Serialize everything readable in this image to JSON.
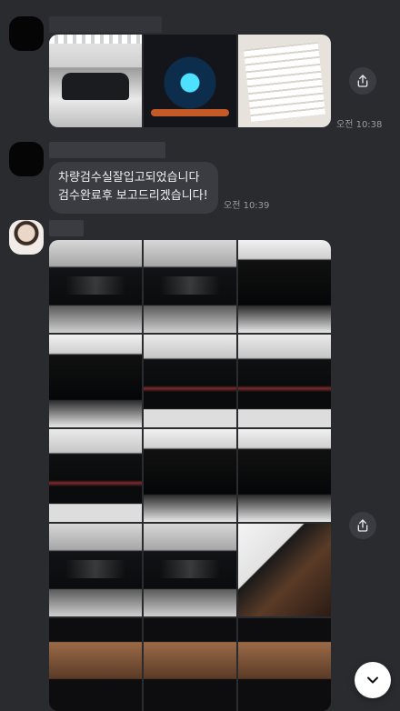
{
  "messages": [
    {
      "time": "오전 10:38",
      "sender_name": "",
      "attachments": [
        "showroom-front-photo",
        "dashboard-cluster-photo",
        "inspection-document-photo"
      ]
    },
    {
      "time": "오전 10:39",
      "sender_name": "",
      "text_lines": [
        "차량검수실잘입고되었습니다",
        "검수완료후 보고드리겠습니다!"
      ]
    },
    {
      "time": "",
      "sender_name": "",
      "attachments_count": 15
    }
  ],
  "icons": {
    "share": "share-icon",
    "scroll_down": "chevron-down-icon"
  },
  "colors": {
    "background": "#2a2b2f",
    "bubble": "#3b3c41",
    "share_button": "#3b3c42"
  }
}
